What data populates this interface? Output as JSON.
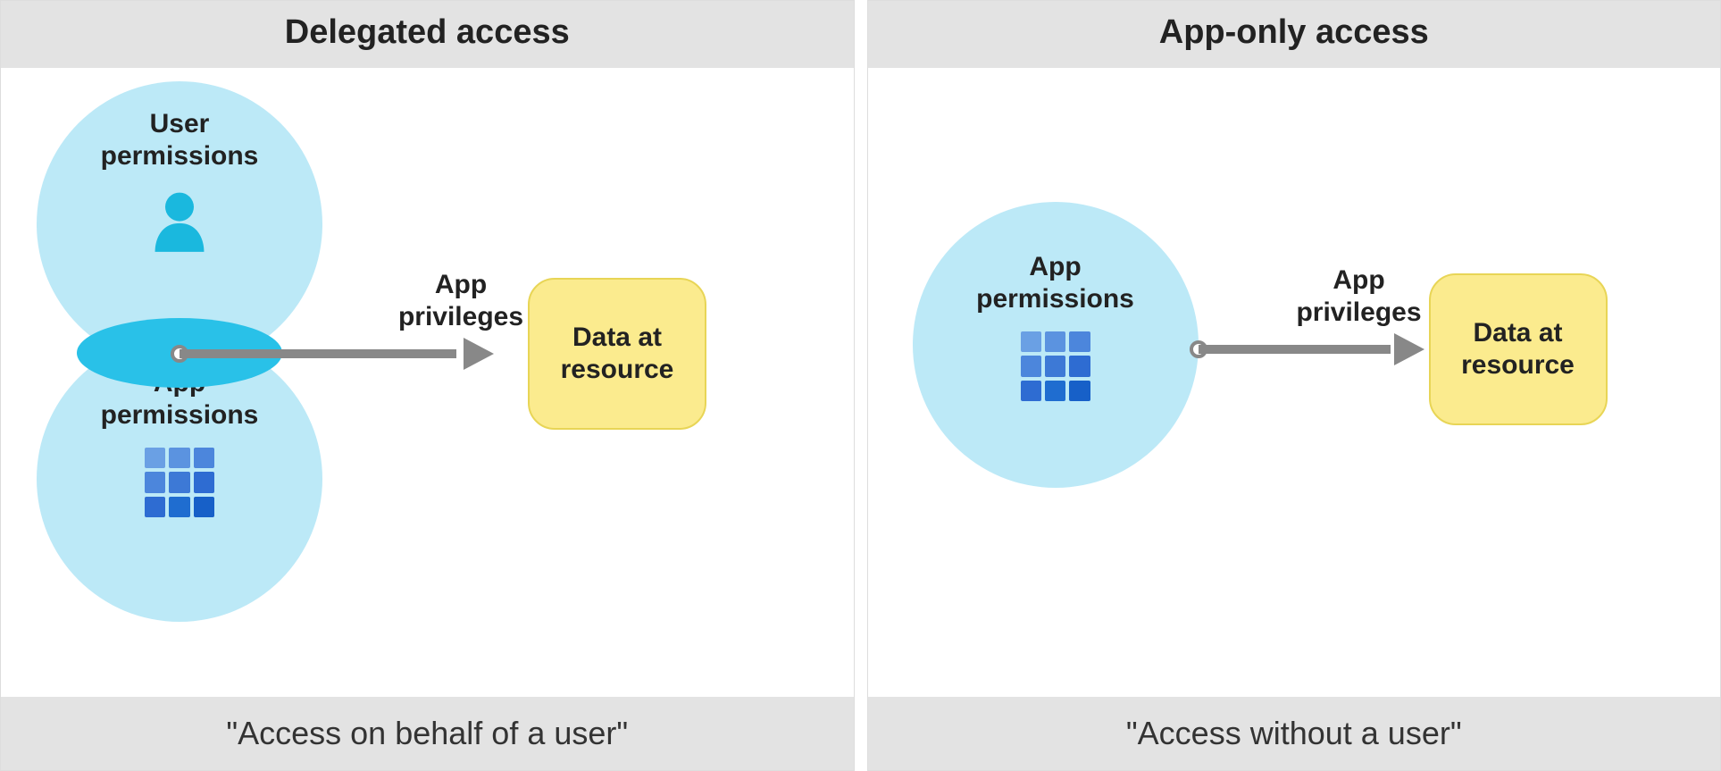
{
  "left": {
    "title": "Delegated access",
    "footer": "\"Access on behalf of a user\"",
    "user_circle_label_l1": "User",
    "user_circle_label_l2": "permissions",
    "app_circle_label_l1": "App",
    "app_circle_label_l2": "permissions",
    "arrow_label_l1": "App",
    "arrow_label_l2": "privileges",
    "resource_l1": "Data at",
    "resource_l2": "resource"
  },
  "right": {
    "title": "App-only access",
    "footer": "\"Access without a user\"",
    "app_circle_label_l1": "App",
    "app_circle_label_l2": "permissions",
    "arrow_label_l1": "App",
    "arrow_label_l2": "privileges",
    "resource_l1": "Data at",
    "resource_l2": "resource"
  },
  "colors": {
    "circle": "#bce9f7",
    "lens": "#29c1e8",
    "resource_bg": "#fbeb8e",
    "arrow": "#888",
    "grid_dark": "#1f6dd0",
    "grid_light": "#5b93e0",
    "user_icon": "#1ab8de"
  },
  "icons": {
    "user": "user-icon",
    "app_grid": "grid-icon"
  }
}
